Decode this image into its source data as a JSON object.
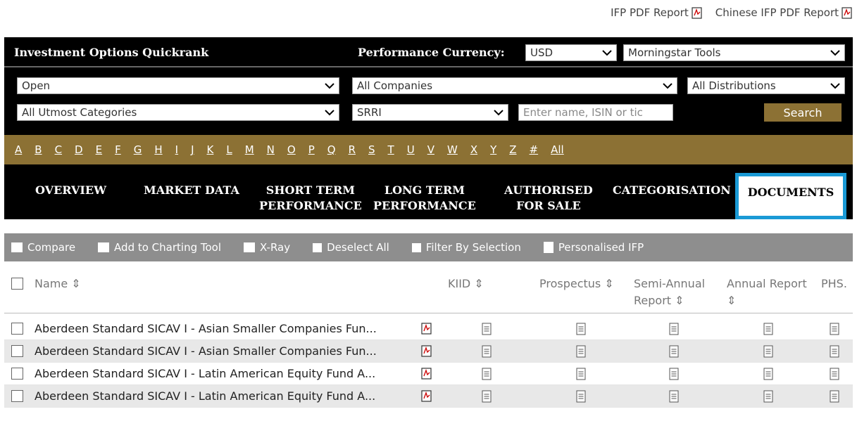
{
  "top_links": {
    "ifp_pdf": "IFP PDF Report",
    "chinese_ifp_pdf": "Chinese IFP PDF Report"
  },
  "header": {
    "title": "Investment Options Quickrank",
    "perf_currency_label": "Performance Currency:",
    "currency_value": "USD",
    "tools_value": "Morningstar Tools"
  },
  "filters": {
    "status": "Open",
    "companies": "All Companies",
    "distributions": "All Distributions",
    "categories": "All Utmost Categories",
    "srri": "SRRI",
    "search_placeholder": "Enter name,  ISIN or tic",
    "search_label": "Search"
  },
  "alphabet": [
    "A",
    "B",
    "C",
    "D",
    "E",
    "F",
    "G",
    "H",
    "I",
    "J",
    "K",
    "L",
    "M",
    "N",
    "O",
    "P",
    "Q",
    "R",
    "S",
    "T",
    "U",
    "V",
    "W",
    "X",
    "Y",
    "Z",
    "#",
    "All"
  ],
  "tabs": {
    "overview": "OVERVIEW",
    "market_data": "MARKET DATA",
    "short_term_1": "SHORT TERM",
    "short_term_2": "PERFORMANCE",
    "long_term_1": "LONG TERM",
    "long_term_2": "PERFORMANCE",
    "authorised_1": "AUTHORISED",
    "authorised_2": "FOR SALE",
    "categorisation": "CATEGORISATION",
    "documents": "DOCUMENTS"
  },
  "toolbar": {
    "compare": "Compare",
    "add_charting": "Add to Charting Tool",
    "xray": "X-Ray",
    "deselect": "Deselect All",
    "filter_selection": "Filter By Selection",
    "personalised_ifp": "Personalised IFP"
  },
  "columns": {
    "name": "Name ⇕",
    "kiid": "KIID ⇕",
    "prospectus": "Prospectus ⇕",
    "semi_annual_1": "Semi-Annual",
    "semi_annual_2": "Report ⇕",
    "annual_1": "Annual Report",
    "annual_2": "⇕",
    "phs": "PHS."
  },
  "rows": [
    {
      "name": "Aberdeen Standard SICAV I - Asian Smaller Companies Fun..."
    },
    {
      "name": "Aberdeen Standard SICAV I - Asian Smaller Companies Fun..."
    },
    {
      "name": "Aberdeen Standard SICAV I - Latin American Equity Fund A..."
    },
    {
      "name": "Aberdeen Standard SICAV I - Latin American Equity Fund A..."
    }
  ],
  "colors": {
    "gold": "#8c7134",
    "active_tab_border": "#1a9ad6",
    "toolbar": "#8e8e8e"
  }
}
